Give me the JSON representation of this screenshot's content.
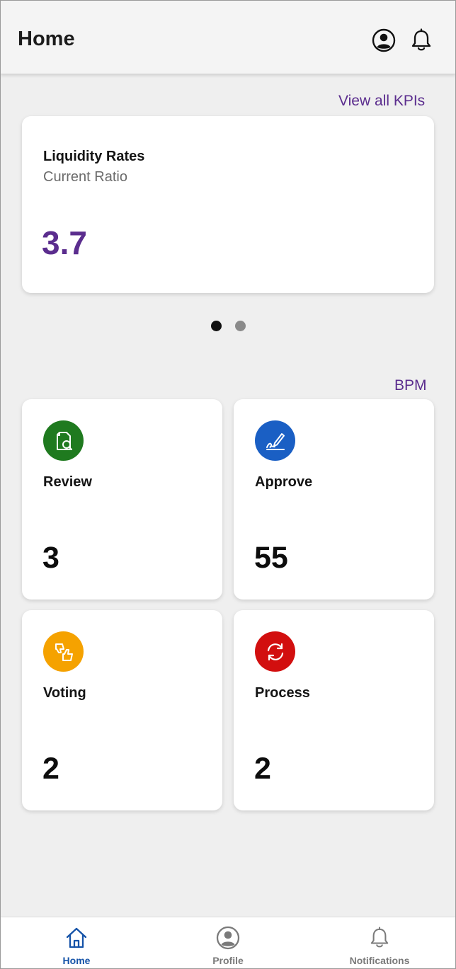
{
  "header": {
    "title": "Home",
    "profile_icon": "account-circle-icon",
    "notifications_icon": "bell-icon"
  },
  "kpi": {
    "view_all_label": "View all KPIs",
    "card": {
      "title": "Liquidity Rates",
      "subtitle": "Current Ratio",
      "value": "3.7"
    },
    "pagination": {
      "pages": 2,
      "active_index": 0
    }
  },
  "bpm": {
    "section_label": "BPM",
    "tiles": [
      {
        "label": "Review",
        "count": "3",
        "icon": "document-search-icon",
        "color": "#1f7a1f"
      },
      {
        "label": "Approve",
        "count": "55",
        "icon": "signature-pen-icon",
        "color": "#1a5fc4"
      },
      {
        "label": "Voting",
        "count": "2",
        "icon": "thumbs-up-down-icon",
        "color": "#f5a200"
      },
      {
        "label": "Process",
        "count": "2",
        "icon": "refresh-cycle-icon",
        "color": "#d20f0f"
      }
    ]
  },
  "bottom_nav": {
    "items": [
      {
        "label": "Home",
        "icon": "home-icon",
        "active": true
      },
      {
        "label": "Profile",
        "icon": "profile-icon",
        "active": false
      },
      {
        "label": "Notifications",
        "icon": "bell-icon",
        "active": false
      }
    ]
  },
  "colors": {
    "accent": "#5b2d8e",
    "nav_active": "#1553a8",
    "nav_inactive": "#7a7a7a",
    "dot_active": "#111111",
    "dot_inactive": "#8a8a8a"
  }
}
